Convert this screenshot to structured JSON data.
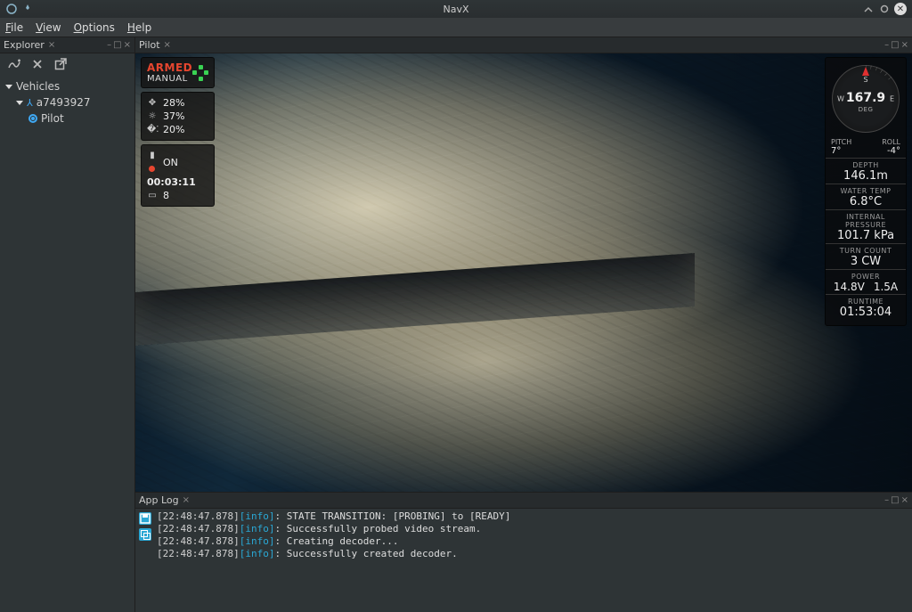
{
  "app": {
    "title": "NavX"
  },
  "menu": {
    "file": "File",
    "view": "View",
    "options": "Options",
    "help": "Help"
  },
  "explorer": {
    "tab": "Explorer",
    "tree": {
      "root": "Vehicles",
      "vehicle": "a7493927",
      "pilot": "Pilot"
    }
  },
  "pilot": {
    "tab": "Pilot",
    "status": {
      "armed": "ARMED",
      "mode": "MANUAL"
    },
    "gains": {
      "thrust": "28%",
      "light": "37%",
      "tilt": "20%"
    },
    "recording": {
      "state": "ON",
      "elapsed": "00:03:11",
      "clips": "8"
    },
    "compass": {
      "heading": "167.9",
      "unit": "DEG",
      "n": "S",
      "w": "W",
      "e": "E",
      "pitch_label": "PITCH",
      "pitch": "7°",
      "roll_label": "ROLL",
      "roll": "-4°"
    },
    "telemetry": {
      "depth_label": "DEPTH",
      "depth": "146.1m",
      "temp_label": "WATER TEMP",
      "temp": "6.8°C",
      "press_label": "INTERNAL PRESSURE",
      "press": "101.7 kPa",
      "turns_label": "TURN COUNT",
      "turns": "3 CW",
      "power_label": "POWER",
      "volts": "14.8V",
      "amps": "1.5A",
      "runtime_label": "RUNTIME",
      "runtime": "01:53:04"
    }
  },
  "applog": {
    "tab": "App Log",
    "lines": [
      {
        "ts": "[22:48:47.878]",
        "lvl": "[info]",
        "msg": ": STATE TRANSITION: [PROBING] to [READY]"
      },
      {
        "ts": "[22:48:47.878]",
        "lvl": "[info]",
        "msg": ": Successfully probed video stream."
      },
      {
        "ts": "[22:48:47.878]",
        "lvl": "[info]",
        "msg": ": Creating decoder..."
      },
      {
        "ts": "[22:48:47.878]",
        "lvl": "[info]",
        "msg": ": Successfully created decoder."
      }
    ]
  }
}
